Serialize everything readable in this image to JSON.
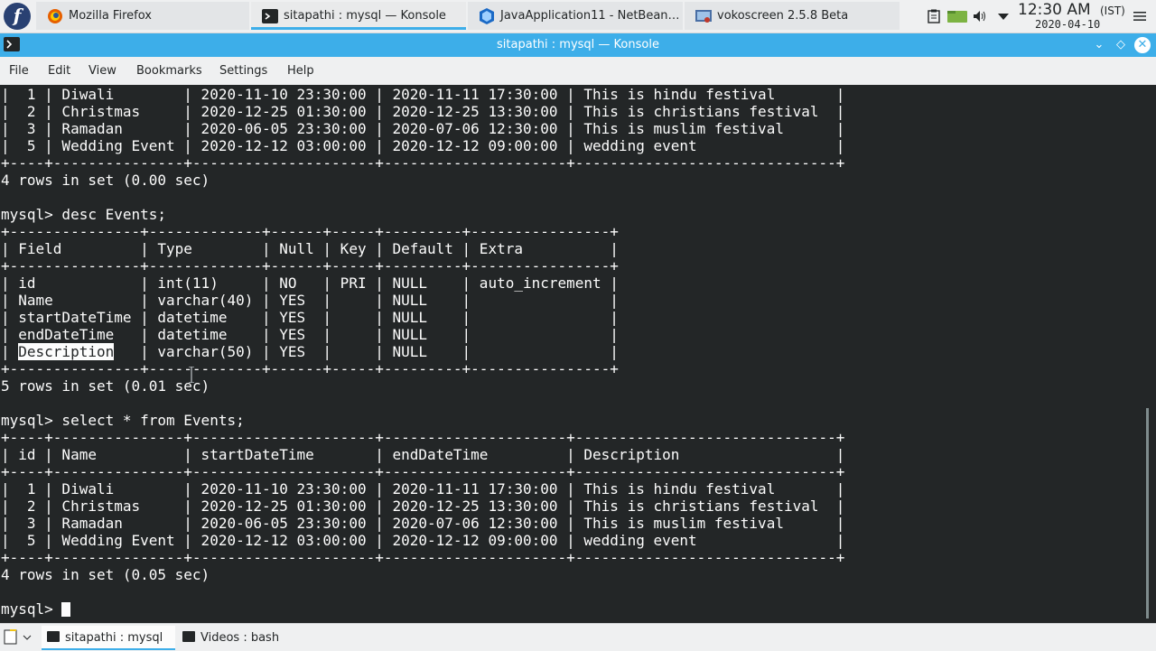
{
  "taskbar": {
    "tasks": [
      {
        "label": "Mozilla Firefox",
        "icon": "firefox-icon"
      },
      {
        "label": "sitapathi : mysql — Konsole",
        "icon": "terminal-icon"
      },
      {
        "label": "JavaApplication11 - NetBean…",
        "icon": "netbeans-icon"
      },
      {
        "label": "vokoscreen 2.5.8 Beta",
        "icon": "vokoscreen-icon"
      }
    ],
    "clock": {
      "time": "12:30 AM",
      "tz": "(IST)",
      "date": "2020-04-10"
    }
  },
  "window": {
    "title": "sitapathi : mysql — Konsole"
  },
  "menubar": [
    "File",
    "Edit",
    "View",
    "Bookmarks",
    "Settings",
    "Help"
  ],
  "terminal": {
    "lines": [
      "|  1 | Diwali        | 2020-11-10 23:30:00 | 2020-11-11 17:30:00 | This is hindu festival       |",
      "|  2 | Christmas     | 2020-12-25 01:30:00 | 2020-12-25 13:30:00 | This is christians festival  |",
      "|  3 | Ramadan       | 2020-06-05 23:30:00 | 2020-07-06 12:30:00 | This is muslim festival      |",
      "|  5 | Wedding Event | 2020-12-12 03:00:00 | 2020-12-12 09:00:00 | wedding event                |",
      "+----+---------------+---------------------+---------------------+------------------------------+",
      "4 rows in set (0.00 sec)",
      "",
      "mysql> desc Events;",
      "+---------------+-------------+------+-----+---------+----------------+",
      "| Field         | Type        | Null | Key | Default | Extra          |",
      "+---------------+-------------+------+-----+---------+----------------+",
      "| id            | int(11)     | NO   | PRI | NULL    | auto_increment |",
      "| Name          | varchar(40) | YES  |     | NULL    |                |",
      "| startDateTime | datetime    | YES  |     | NULL    |                |",
      "| endDateTime   | datetime    | YES  |     | NULL    |                |",
      "| Description   | varchar(50) | YES  |     | NULL    |                |",
      "+---------------+-------------+------+-----+---------+----------------+",
      "5 rows in set (0.01 sec)",
      "",
      "mysql> select * from Events;",
      "+----+---------------+---------------------+---------------------+------------------------------+",
      "| id | Name          | startDateTime       | endDateTime         | Description                  |",
      "+----+---------------+---------------------+---------------------+------------------------------+",
      "|  1 | Diwali        | 2020-11-10 23:30:00 | 2020-11-11 17:30:00 | This is hindu festival       |",
      "|  2 | Christmas     | 2020-12-25 01:30:00 | 2020-12-25 13:30:00 | This is christians festival  |",
      "|  3 | Ramadan       | 2020-06-05 23:30:00 | 2020-07-06 12:30:00 | This is muslim festival      |",
      "|  5 | Wedding Event | 2020-12-12 03:00:00 | 2020-12-12 09:00:00 | wedding event                |",
      "+----+---------------+---------------------+---------------------+------------------------------+",
      "4 rows in set (0.05 sec)",
      ""
    ],
    "highlight": {
      "line": 15,
      "text": "Description"
    },
    "prompt": "mysql> "
  },
  "bottom_tabs": [
    {
      "label": "sitapathi : mysql"
    },
    {
      "label": "Videos : bash"
    }
  ],
  "colors": {
    "accent": "#3daee9",
    "terminal_bg": "#232627",
    "terminal_fg": "#fcfcfc"
  }
}
